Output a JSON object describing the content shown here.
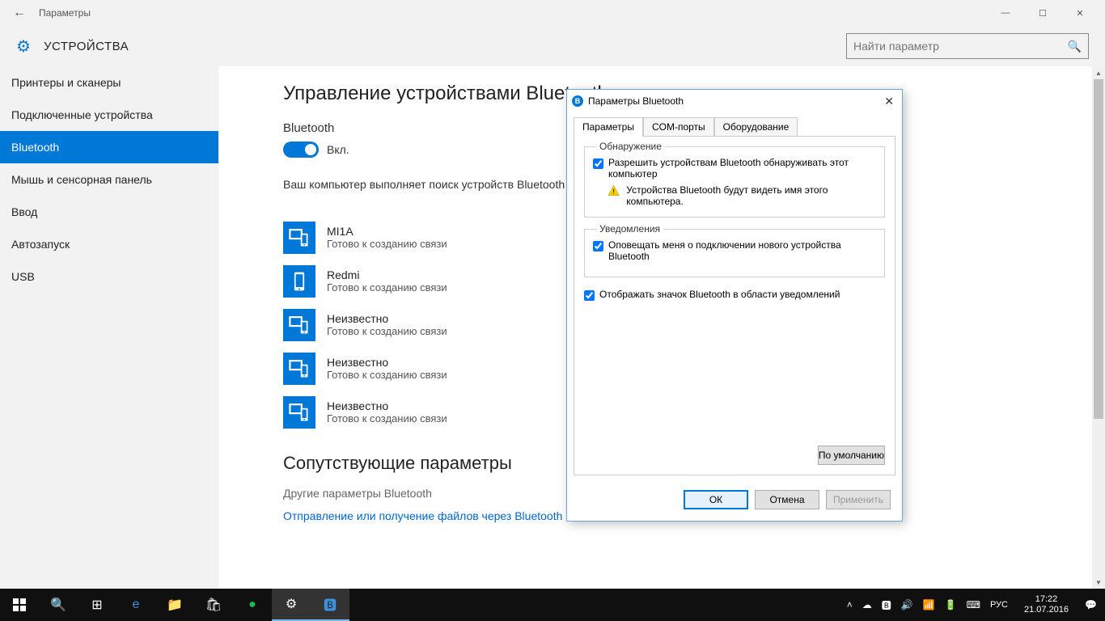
{
  "titlebar": {
    "title": "Параметры"
  },
  "header": {
    "page_title": "УСТРОЙСТВА",
    "search_placeholder": "Найти параметр"
  },
  "sidebar": {
    "items": [
      {
        "label": "Принтеры и сканеры"
      },
      {
        "label": "Подключенные устройства"
      },
      {
        "label": "Bluetooth"
      },
      {
        "label": "Мышь и сенсорная панель"
      },
      {
        "label": "Ввод"
      },
      {
        "label": "Автозапуск"
      },
      {
        "label": "USB"
      }
    ]
  },
  "main": {
    "heading": "Управление устройствами Bluetooth",
    "bt_label": "Bluetooth",
    "toggle_state": "Вкл.",
    "description": "Ваш компьютер выполняет поиск устройств Bluetooth и может быть обнаружен ими.",
    "devices": [
      {
        "name": "MI1A",
        "status": "Готово к созданию связи",
        "type": "multi"
      },
      {
        "name": "Redmi",
        "status": "Готово к созданию связи",
        "type": "phone"
      },
      {
        "name": "Неизвестно",
        "status": "Готово к созданию связи",
        "type": "multi"
      },
      {
        "name": "Неизвестно",
        "status": "Готово к созданию связи",
        "type": "multi"
      },
      {
        "name": "Неизвестно",
        "status": "Готово к созданию связи",
        "type": "multi"
      }
    ],
    "related_heading": "Сопутствующие параметры",
    "related_links": [
      {
        "label": "Другие параметры Bluetooth",
        "blue": false
      },
      {
        "label": "Отправление или получение файлов через Bluetooth",
        "blue": true
      }
    ]
  },
  "dialog": {
    "title": "Параметры Bluetooth",
    "tabs": [
      "Параметры",
      "COM-порты",
      "Оборудование"
    ],
    "group1_title": "Обнаружение",
    "chk1": "Разрешить устройствам Bluetooth обнаруживать этот компьютер",
    "warn": "Устройства Bluetooth будут видеть имя этого компьютера.",
    "group2_title": "Уведомления",
    "chk2": "Оповещать меня о подключении нового устройства Bluetooth",
    "chk3": "Отображать значок Bluetooth в области уведомлений",
    "defaults_btn": "По умолчанию",
    "ok": "ОК",
    "cancel": "Отмена",
    "apply": "Применить"
  },
  "taskbar": {
    "lang": "РУС",
    "time": "17:22",
    "date": "21.07.2016"
  }
}
